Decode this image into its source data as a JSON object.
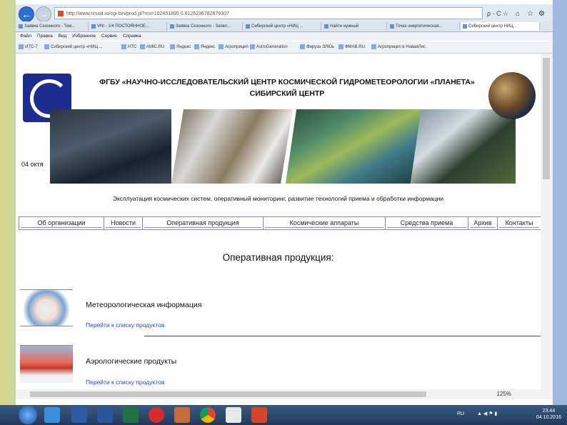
{
  "browser": {
    "url": "http://www.rcsod.ru/cgi-bin/prod.pl?rcs=102451895 0.6125236782879307",
    "url_tools": "ρ - C ☆",
    "window_controls": [
      "⌂",
      "☆",
      "⚙"
    ],
    "tabs": [
      {
        "label": "Заявка Сезонного - Тем..."
      },
      {
        "label": "VNI - 1/4 ПОСТОЯННОЕ..."
      },
      {
        "label": "Заявка Сезонного - Заявл..."
      },
      {
        "label": "Сибирский центр «НИЦ ..."
      },
      {
        "label": "Найти нужный"
      },
      {
        "label": "Точка энергетическая..."
      },
      {
        "label": "Сибирский центр НИЦ..."
      }
    ],
    "menu": [
      "Файл",
      "Правка",
      "Вид",
      "Избранное",
      "Сервис",
      "Справка"
    ],
    "favorites": [
      "ИТС-7",
      "Сибирский центр «НИЦ ...",
      "НТС",
      "AMIC.RU",
      "Яндекс",
      "Яндекс",
      "Агроприцеп",
      "AstroGeneration",
      "Фируза ЭЛЮь",
      "ФМАВ.RU",
      "Агроприцеп в НоваяЛес"
    ]
  },
  "page": {
    "org_title_line1": "ФГБУ «НАУЧНО-ИССЛЕДОВАТЕЛЬСКИЙ ЦЕНТР КОСМИЧЕСКОЙ ГИДРОМЕТЕОРОЛОГИИ «ПЛАНЕТА»",
    "org_title_line2": "СИБИРСКИЙ ЦЕНТР",
    "date": "04 октя",
    "subtitle": "Эксплуатация космических систем, оперативный мониторинг, развитие технологий приема и обработки информации",
    "nav": [
      "Об организации",
      "Новости",
      "Оперативная продукция",
      "Космические аппараты",
      "Средства приема",
      "Архив",
      "Контакты"
    ],
    "heading": "Оперативная продукция:",
    "products": [
      {
        "title": "Метеорологическая информация",
        "link": "Перейти к списку продуктов"
      },
      {
        "title": "Аэрологические продукты",
        "link": "Перейти к списку продуктов"
      }
    ]
  },
  "taskbar": {
    "lang": "RU",
    "time": "23:44",
    "date": "04.10.2016",
    "zoom": "125%"
  }
}
